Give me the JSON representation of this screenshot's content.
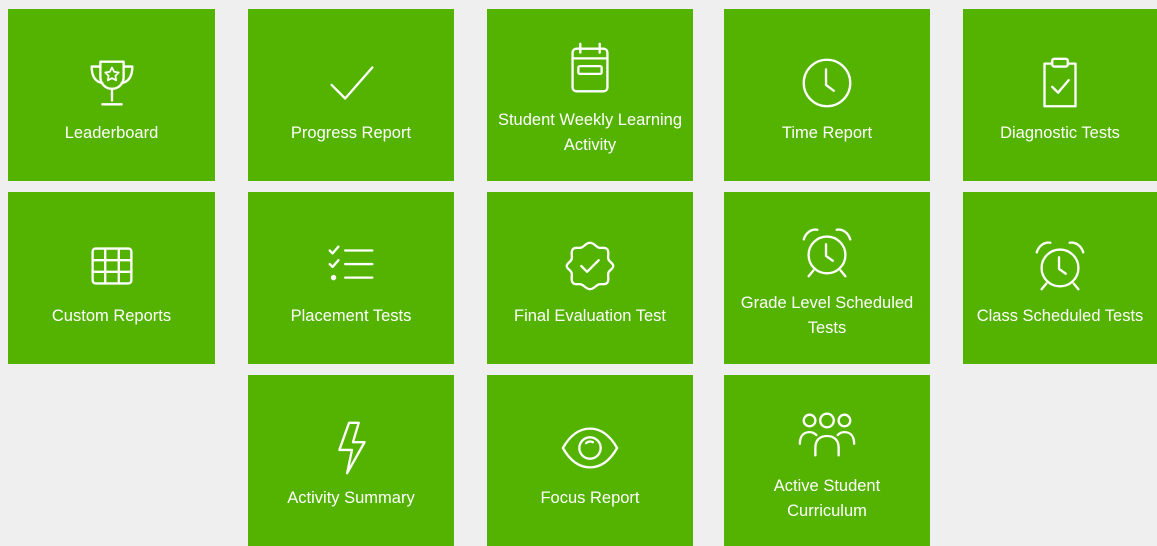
{
  "tiles": [
    {
      "label": "Leaderboard",
      "icon": "trophy-icon"
    },
    {
      "label": "Progress Report",
      "icon": "checkmark-icon"
    },
    {
      "label": "Student Weekly Learning Activity",
      "icon": "calendar-icon"
    },
    {
      "label": "Time Report",
      "icon": "clock-icon"
    },
    {
      "label": "Diagnostic Tests",
      "icon": "clipboard-check-icon"
    },
    {
      "label": "Custom Reports",
      "icon": "table-icon"
    },
    {
      "label": "Placement Tests",
      "icon": "checklist-icon"
    },
    {
      "label": "Final Evaluation Test",
      "icon": "badge-check-icon"
    },
    {
      "label": "Grade Level Scheduled Tests",
      "icon": "alarm-clock-icon"
    },
    {
      "label": "Class Scheduled Tests",
      "icon": "alarm-clock-icon"
    },
    {
      "label": "Activity Summary",
      "icon": "lightning-icon"
    },
    {
      "label": "Focus Report",
      "icon": "eye-icon"
    },
    {
      "label": "Active Student Curriculum",
      "icon": "users-group-icon"
    }
  ],
  "colors": {
    "tile": "#53b300",
    "background": "#efefef",
    "text": "#ffffff"
  }
}
